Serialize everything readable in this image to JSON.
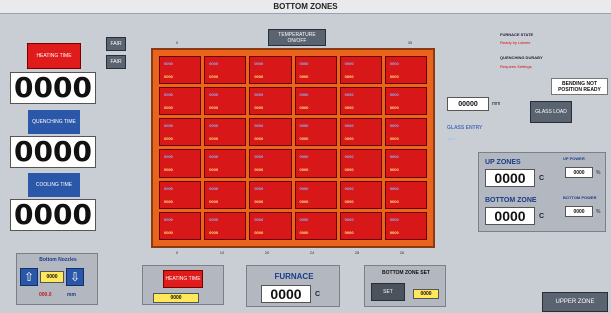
{
  "header": {
    "title": "BOTTOM ZONES"
  },
  "left": {
    "heating_time_label": "HEATING TIME",
    "heating_time_value": "0000",
    "quenching_time_label": "QUENCHING TIME",
    "quenching_time_value": "0000",
    "cooling_time_label": "COOLING TIME",
    "cooling_time_value": "0000",
    "mode_btn_1": "FAIR",
    "mode_btn_2": "FAIR"
  },
  "nozzles": {
    "label": "Bottom Nozzles",
    "value": "0000",
    "readout": "000.0",
    "unit": "mm"
  },
  "grid": {
    "temp_button": "TEMPERATURE ON/OFF",
    "top_ticks": [
      "0",
      "35"
    ],
    "bottom_ticks": [
      "0",
      "10",
      "20",
      "24",
      "28",
      "26"
    ],
    "cell_temp_label": "0000",
    "cell_value": "0000"
  },
  "status": {
    "furnace_state_label": "FURNACE STATE",
    "furnace_state_value": "Ready by Labree",
    "quenching_label": "QUENCHING DURABY",
    "quenching_value": "Requires Settings",
    "bending_warning": "BENDING NOT POSITION READY"
  },
  "glass": {
    "length_value": "00000",
    "length_unit": "mm",
    "load_button": "GLASS LOAD",
    "entry_label": "GLASS ENTRY"
  },
  "zones": {
    "up_label": "UP ZONES",
    "up_value": "0000",
    "up_unit": "C",
    "up_power_label": "UP POWER",
    "up_power_value": "0000",
    "up_power_unit": "%",
    "bottom_label": "BOTTOM ZONE",
    "bottom_value": "0000",
    "bottom_unit": "C",
    "bottom_power_label": "BOTTOM POWER",
    "bottom_power_value": "0000",
    "bottom_power_unit": "%"
  },
  "footer": {
    "heating_time_label": "HEATING TIME",
    "heating_time_value": "0000",
    "furnace_label": "FURNACE",
    "furnace_value": "0000",
    "furnace_unit": "C",
    "bottom_zone_set_label": "BOTTOM ZONE SET",
    "set_button": "SET",
    "set_value": "0000",
    "upper_zone_button": "UPPER ZONE"
  },
  "colors": {
    "cell_red": "#d81818",
    "frame_orange": "#e9651e",
    "label_blue": "#2b57a8"
  }
}
